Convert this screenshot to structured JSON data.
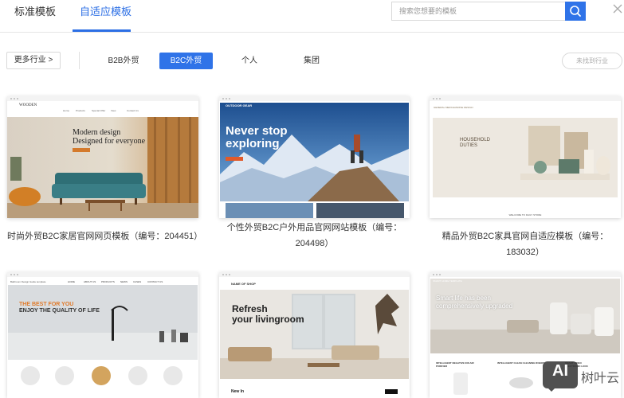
{
  "tabs": [
    "标准模板",
    "自适应模板"
  ],
  "search": {
    "placeholder": "搜索您想要的模板"
  },
  "filter": {
    "more_label": "更多行业 >",
    "chips": [
      "B2B外贸",
      "B2C外贸",
      "个人",
      "集团"
    ],
    "active_chip": "B2C外贸",
    "not_found_label": "未找到行业"
  },
  "cards": [
    {
      "title": "时尚外贸B2C家居官网网页模板（编号：204451）",
      "preview": {
        "brand": "WOODEN",
        "nav": [
          "Home",
          "Products",
          "Special Offer",
          "View",
          "Contact Us"
        ],
        "hero_line1": "Modern design",
        "hero_line2": "Designed for everyone"
      }
    },
    {
      "title_line1": "个性外贸B2C户外用品官网网站模板（编号：",
      "title_line2": "204498）",
      "preview": {
        "brand": "OUTDOOR GEAR",
        "hero_line1": "Never stop",
        "hero_line2": "exploring"
      }
    },
    {
      "title": "精品外贸B2C家具官网自适应模板（编号：183032）",
      "preview": {
        "brand": "GENERAL MERCHANDISE DESIGN",
        "hero_line1": "HOUSEHOLD",
        "hero_line2": "DUTIES",
        "footer": "WELCOME TO DAILY STORE"
      }
    },
    {
      "preview": {
        "brand": "Bathroom Design Guide template",
        "nav": [
          "HOME",
          "ABOUT US",
          "PRODUCTS",
          "NEWS",
          "CASES",
          "CONTACT US"
        ],
        "hero_line1": "THE BEST FOR YOU",
        "hero_line2": "ENJOY THE QUALITY OF LIFE"
      }
    },
    {
      "preview": {
        "brand": "NAME OF SHOP",
        "hero_line1": "Refresh",
        "hero_line2": "your livingroom",
        "footer": "New In"
      }
    },
    {
      "preview": {
        "brand": "SMART HOME TEMPLATE",
        "hero_line1": "Smart life has been",
        "hero_line2": "comprehensively upgraded",
        "features": [
          "INTELLIGENT NEGATIVE ION AIR PURIFIER",
          "INTELLIGENT CLEAN CLEANING ROBOT",
          "SMART VIDEO ELECTRONIC LOCK"
        ]
      }
    }
  ],
  "watermark": {
    "logo": "AI",
    "text": "树叶云"
  }
}
